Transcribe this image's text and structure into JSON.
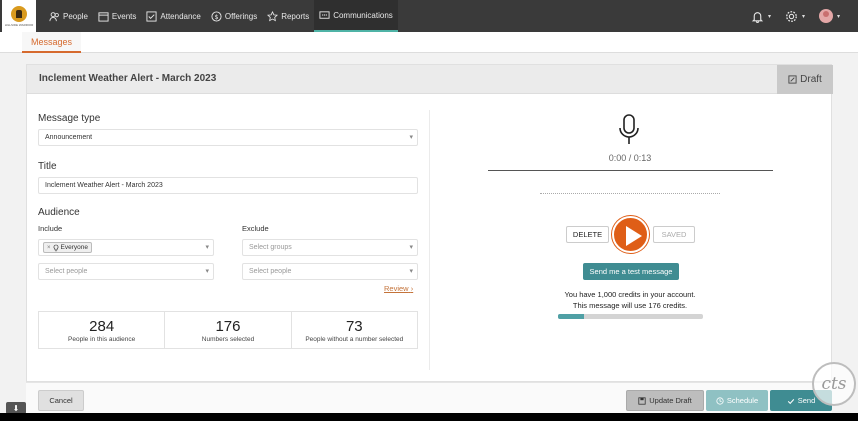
{
  "logo": {
    "text": "HILLSIDE WARRIOR"
  },
  "nav": {
    "items": [
      {
        "label": "People",
        "icon": "people-icon"
      },
      {
        "label": "Events",
        "icon": "calendar-icon"
      },
      {
        "label": "Attendance",
        "icon": "checkbox-icon"
      },
      {
        "label": "Offerings",
        "icon": "dollar-icon"
      },
      {
        "label": "Reports",
        "icon": "star-icon"
      },
      {
        "label": "Communications",
        "icon": "message-icon"
      }
    ],
    "active": "Communications"
  },
  "subnav": {
    "tab": "Messages"
  },
  "card": {
    "title": "Inclement Weather Alert - March 2023",
    "status": "Draft"
  },
  "form": {
    "message_type_label": "Message type",
    "message_type_value": "Announcement",
    "title_label": "Title",
    "title_value": "Inclement Weather Alert - March 2023",
    "audience_label": "Audience",
    "include_label": "Include",
    "exclude_label": "Exclude",
    "include_chip": "Everyone",
    "select_people_placeholder": "Select people",
    "select_groups_placeholder": "Select groups",
    "exclude_people_placeholder": "Select people",
    "review_label": "Review"
  },
  "stats": [
    {
      "value": "284",
      "caption": "People in this audience"
    },
    {
      "value": "176",
      "caption": "Numbers selected"
    },
    {
      "value": "73",
      "caption": "People without a number selected"
    }
  ],
  "audio": {
    "timer": "0:00 / 0:13",
    "delete_label": "DELETE",
    "saved_label": "SAVED",
    "test_button": "Send me a test message",
    "credits_line1": "You have 1,000 credits in your account.",
    "credits_line2": "This message will use 176 credits.",
    "credit_usage_fraction": 0.176
  },
  "footer": {
    "cancel": "Cancel",
    "update_draft": "Update Draft",
    "schedule": "Schedule",
    "send": "Send"
  },
  "colors": {
    "accent_orange": "#df5e17",
    "teal": "#3f8c92",
    "nav_bg": "#3a3a3a"
  },
  "watermark": "cts"
}
